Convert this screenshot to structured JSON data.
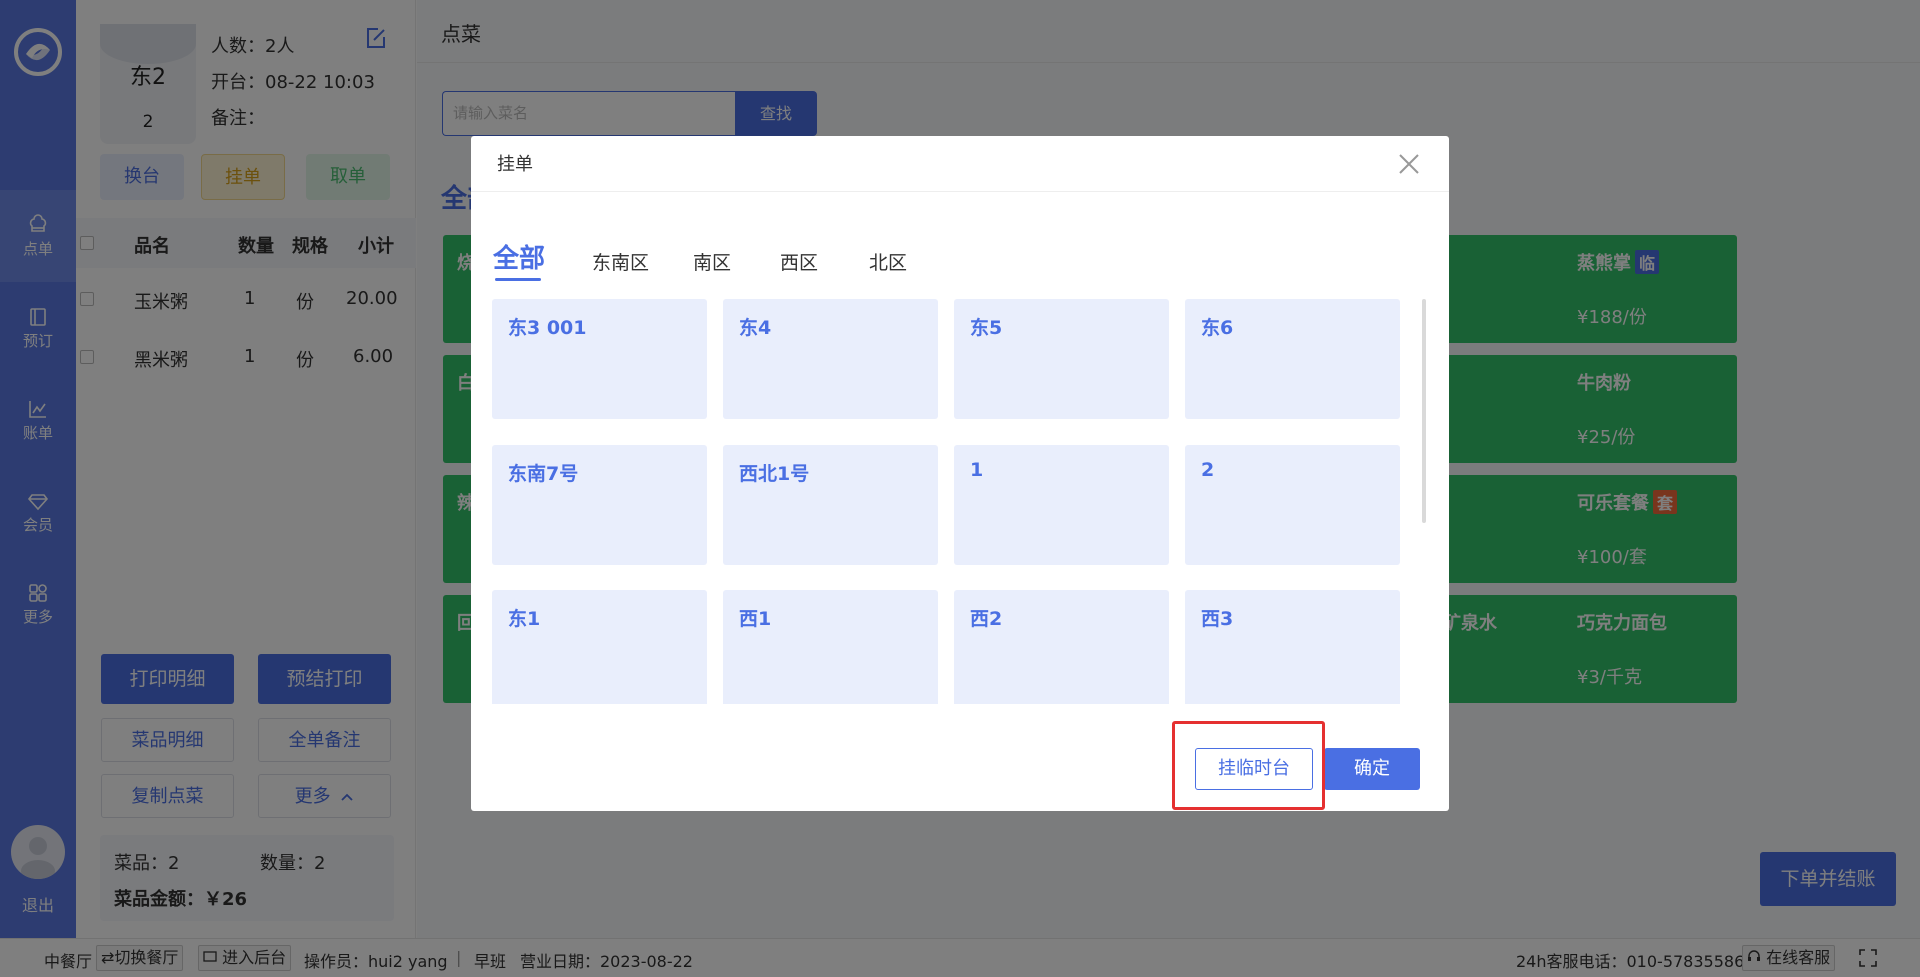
{
  "nav": {
    "items": [
      {
        "label": "点单",
        "icon": "chef-hat-icon"
      },
      {
        "label": "预订",
        "icon": "book-icon"
      },
      {
        "label": "账单",
        "icon": "chart-icon"
      },
      {
        "label": "会员",
        "icon": "diamond-icon"
      },
      {
        "label": "更多",
        "icon": "grid-icon"
      }
    ],
    "logout": "退出"
  },
  "order": {
    "table_name": "东2",
    "table_no": "2",
    "people": "人数：2人",
    "open_time": "开台：08-22 10:03",
    "note": "备注：",
    "actions": {
      "swap": "换台",
      "hang": "挂单",
      "cancel": "取单"
    },
    "columns": [
      "品名",
      "数量",
      "规格",
      "小计"
    ],
    "rows": [
      {
        "name": "玉米粥",
        "qty": "1",
        "unit": "份",
        "subtotal": "20.00"
      },
      {
        "name": "黑米粥",
        "qty": "1",
        "unit": "份",
        "subtotal": "6.00"
      }
    ],
    "buttons": {
      "print_detail": "打印明细",
      "pre_print": "预结打印",
      "dish_detail": "菜品明细",
      "all_note": "全单备注",
      "copy_order": "复制点菜",
      "more": "更多"
    },
    "summary": {
      "dishes": "菜品：2",
      "count": "数量：2",
      "amount": "菜品金额：￥26"
    }
  },
  "main": {
    "title": "点菜",
    "search_placeholder": "请输入菜名",
    "search_button": "查找",
    "category_all": "全部",
    "visible_dishes": [
      {
        "name": "蒸熊掌",
        "tag": "临",
        "price": "¥188/份"
      },
      {
        "name": "牛肉粉",
        "tag": "",
        "price": "¥25/份"
      },
      {
        "name": "可乐套餐",
        "tag": "套",
        "price": "¥100/套"
      },
      {
        "name": "巧克力面包",
        "tag": "",
        "price": "¥3/千克"
      }
    ],
    "partial_dish_name": "矿泉水",
    "left_partial_initials": [
      "烧",
      "白",
      "辣",
      "回"
    ],
    "submit": "下单并结账"
  },
  "footer": {
    "restaurant": "中餐厅",
    "switch": "⇄切换餐厅",
    "backend": "进入后台",
    "operator": "操作员：hui2 yang",
    "shift": "早班",
    "biz_date": "营业日期：2023-08-22",
    "hotline": "24h客服电话：010-57835586",
    "online_service": "在线客服"
  },
  "modal": {
    "title": "挂单",
    "tabs": [
      "全部",
      "东南区",
      "南区",
      "西区",
      "北区"
    ],
    "tables": [
      "东3 001",
      "东4",
      "东5",
      "东6",
      "东南7号",
      "西北1号",
      "1",
      "2",
      "东1",
      "西1",
      "西2",
      "西3"
    ],
    "btn_temp": "挂临时台",
    "btn_ok": "确定"
  }
}
